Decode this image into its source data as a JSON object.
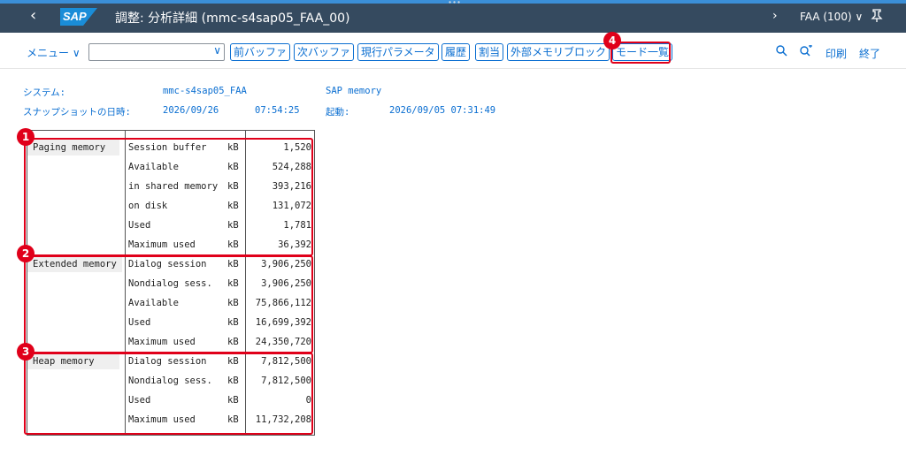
{
  "shell": {
    "title": "調整: 分析詳細 (mmc-s4sap05_FAA_00)",
    "logo": "SAP",
    "client": "FAA (100)",
    "back_icon": "chevron-left-icon",
    "pin_icon": "pin-icon"
  },
  "toolbar": {
    "menu": "メニュー",
    "command_field_value": "",
    "buttons": [
      "前バッファ",
      "次バッファ",
      "現行パラメータ",
      "履歴",
      "割当",
      "外部メモリブロック",
      "モード一覧"
    ],
    "print": "印刷",
    "exit": "終了",
    "icons": [
      "search-icon",
      "search-next-icon"
    ]
  },
  "info": {
    "system_label": "システム:",
    "system_value": "mmc-s4sap05_FAA",
    "memory_label": "SAP memory",
    "snapshot_label": "スナップショットの日時:",
    "snapshot_date": "2026/09/26",
    "snapshot_time": "07:54:25",
    "start_label": "起動:",
    "start_value": "2026/09/05 07:31:49"
  },
  "memory": {
    "sections": [
      {
        "name": "Paging memory",
        "rows": [
          {
            "label": "Session buffer",
            "unit": "kB",
            "value": "1,520"
          },
          {
            "label": "Available",
            "unit": "kB",
            "value": "524,288"
          },
          {
            "label": "in shared memory",
            "unit": "kB",
            "value": "393,216"
          },
          {
            "label": "on disk",
            "unit": "kB",
            "value": "131,072"
          },
          {
            "label": "Used",
            "unit": "kB",
            "value": "1,781"
          },
          {
            "label": "Maximum used",
            "unit": "kB",
            "value": "36,392"
          }
        ]
      },
      {
        "name": "Extended memory",
        "rows": [
          {
            "label": "Dialog session",
            "unit": "kB",
            "value": "3,906,250"
          },
          {
            "label": "Nondialog sess.",
            "unit": "kB",
            "value": "3,906,250"
          },
          {
            "label": "Available",
            "unit": "kB",
            "value": "75,866,112"
          },
          {
            "label": "Used",
            "unit": "kB",
            "value": "16,699,392"
          },
          {
            "label": "Maximum used",
            "unit": "kB",
            "value": "24,350,720"
          }
        ]
      },
      {
        "name": "Heap memory",
        "rows": [
          {
            "label": "Dialog session",
            "unit": "kB",
            "value": "7,812,500"
          },
          {
            "label": "Nondialog sess.",
            "unit": "kB",
            "value": "7,812,500"
          },
          {
            "label": "Used",
            "unit": "kB",
            "value": "0"
          },
          {
            "label": "Maximum used",
            "unit": "kB",
            "value": "11,732,208"
          }
        ]
      }
    ]
  },
  "annotations": [
    "1",
    "2",
    "3",
    "4"
  ],
  "colors": {
    "shell_bg": "#354a5f",
    "accent": "#0a6ed1",
    "highlight": "#e0001a"
  }
}
